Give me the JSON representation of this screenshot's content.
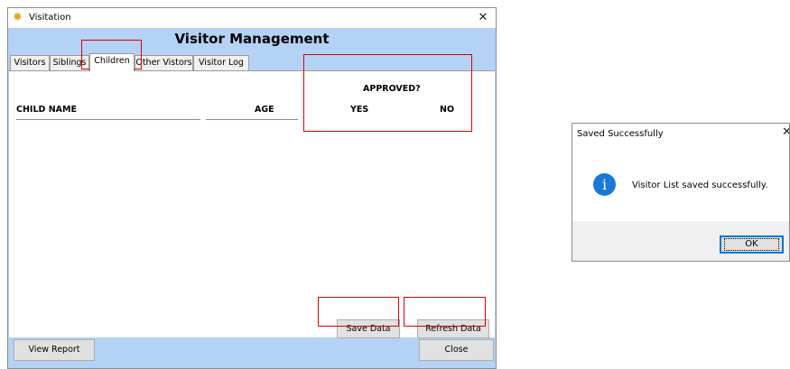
{
  "window": {
    "title": "Visitation",
    "close_glyph": "✕",
    "app_icon": "sun-icon",
    "heading": "Visitor Management"
  },
  "tabs": [
    {
      "label": "Visitors",
      "active": false
    },
    {
      "label": "Siblings",
      "active": false
    },
    {
      "label": "Children",
      "active": true
    },
    {
      "label": "Other Vistors",
      "active": false
    },
    {
      "label": "Visitor Log",
      "active": false
    }
  ],
  "children_panel": {
    "col_child_name": "CHILD NAME",
    "col_age": "AGE",
    "approved_header": "APPROVED?",
    "col_yes": "YES",
    "col_no": "NO",
    "rows": []
  },
  "buttons": {
    "save": "Save Data",
    "refresh": "Refresh Data",
    "view_report": "View Report",
    "close": "Close"
  },
  "dialog": {
    "title": "Saved Successfully",
    "close_glyph": "✕",
    "icon": "info-icon",
    "icon_glyph": "i",
    "message": "Visitor List saved successfully.",
    "ok": "OK"
  },
  "colors": {
    "window_bg": "#b4d2f5",
    "annotation_red": "#e00000",
    "info_blue": "#1a78d6"
  }
}
